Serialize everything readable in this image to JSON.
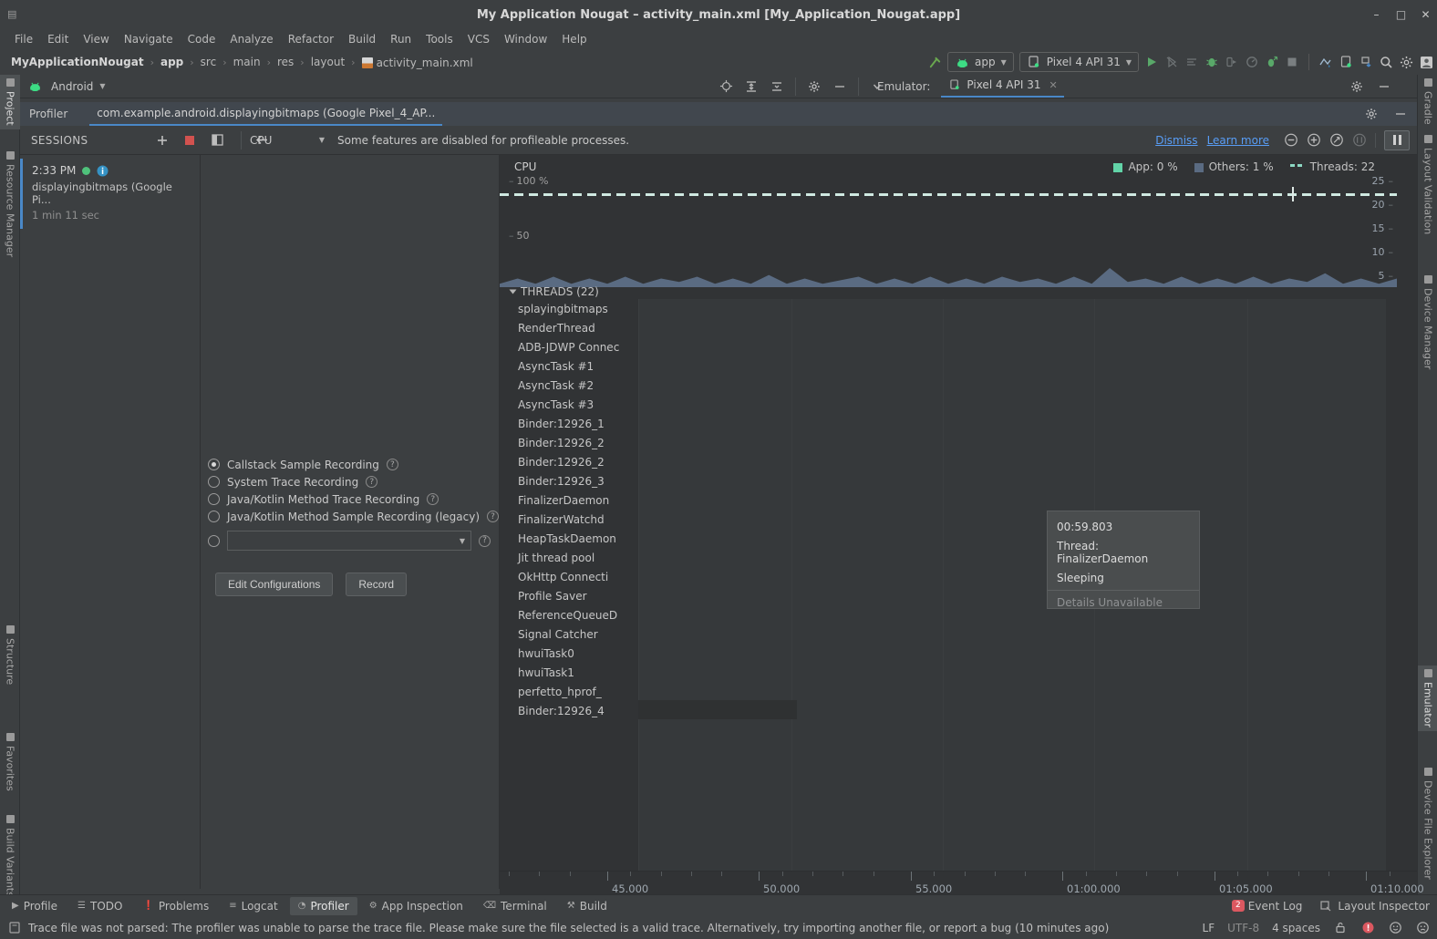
{
  "window": {
    "title": "My Application Nougat – activity_main.xml [My_Application_Nougat.app]",
    "minimize": "–",
    "maximize": "□",
    "close": "✕"
  },
  "menu": {
    "items": [
      "File",
      "Edit",
      "View",
      "Navigate",
      "Code",
      "Analyze",
      "Refactor",
      "Build",
      "Run",
      "Tools",
      "VCS",
      "Window",
      "Help"
    ]
  },
  "breadcrumb": {
    "items": [
      "MyApplicationNougat",
      "app",
      "src",
      "main",
      "res",
      "layout",
      "activity_main.xml"
    ],
    "separator": "›"
  },
  "run_toolbar": {
    "module": "app",
    "device": "Pixel 4 API 31"
  },
  "tool_window": {
    "label": "Android",
    "emulator_label": "Emulator:",
    "emulator_tab": "Pixel 4 API 31",
    "emulator_close": "✕"
  },
  "profiler_tab": {
    "label": "Profiler",
    "session_tab": "com.example.android.displayingbitmaps (Google Pixel_4_AP..."
  },
  "sessions": {
    "title": "SESSIONS",
    "card": {
      "time": "2:33 PM",
      "name": "displayingbitmaps (Google Pi...",
      "duration": "1 min 11 sec"
    }
  },
  "monitor_toolbar": {
    "stage": "CPU",
    "notice": "Some features are disabled for profileable processes.",
    "dismiss": "Dismiss",
    "learn_more": "Learn more"
  },
  "config": {
    "options": [
      {
        "label": "Callstack Sample Recording",
        "selected": true
      },
      {
        "label": "System Trace Recording",
        "selected": false
      },
      {
        "label": "Java/Kotlin Method Trace Recording",
        "selected": false
      },
      {
        "label": "Java/Kotlin Method Sample Recording (legacy)",
        "selected": false
      }
    ],
    "custom_value": "",
    "edit_configurations": "Edit Configurations",
    "record": "Record"
  },
  "cpu": {
    "title": "CPU",
    "legend": [
      {
        "label": "App: 0 %",
        "color": "#62d4a8",
        "style": "swatch"
      },
      {
        "label": "Others: 1 %",
        "color": "#5a6b82",
        "style": "swatch"
      },
      {
        "label": "Threads: 22",
        "color": "#cfe9e1",
        "style": "dashed"
      }
    ],
    "y_left": [
      "100 %",
      "50"
    ],
    "y_right": [
      "25",
      "20",
      "15",
      "10",
      "5"
    ]
  },
  "threads": {
    "header": "THREADS (22)",
    "names": [
      "splayingbitmaps",
      "RenderThread",
      "ADB-JDWP Connec",
      "AsyncTask #1",
      "AsyncTask #2",
      "AsyncTask #3",
      "Binder:12926_1",
      "Binder:12926_2",
      "Binder:12926_2",
      "Binder:12926_3",
      "FinalizerDaemon",
      "FinalizerWatchd",
      "HeapTaskDaemon",
      "Jit thread pool",
      "OkHttp Connecti",
      "Profile Saver",
      "ReferenceQueueD",
      "Signal Catcher",
      "hwuiTask0",
      "hwuiTask1",
      "perfetto_hprof_",
      "Binder:12926_4"
    ]
  },
  "tooltip": {
    "time": "00:59.803",
    "thread": "Thread: FinalizerDaemon",
    "state": "Sleeping",
    "details": "Details Unavailable"
  },
  "timeline": {
    "labels": [
      "45.000",
      "50.000",
      "55.000",
      "01:00.000",
      "01:05.000",
      "01:10.000"
    ]
  },
  "left_rail": {
    "items": [
      "Project",
      "Resource Manager",
      "Structure",
      "Favorites",
      "Build Variants"
    ]
  },
  "right_rail": {
    "items": [
      "Gradle",
      "Layout Validation",
      "Device Manager",
      "Emulator",
      "Device File Explorer"
    ]
  },
  "bottom_tabs": {
    "items": [
      "Profile",
      "TODO",
      "Problems",
      "Logcat",
      "Profiler",
      "App Inspection",
      "Terminal",
      "Build"
    ],
    "active": "Profiler",
    "event_log": "Event Log",
    "event_log_count": "2",
    "layout_inspector": "Layout Inspector"
  },
  "status": {
    "message": "Trace file was not parsed: The profiler was unable to parse the trace file. Please make sure the file selected is a valid trace. Alternatively, try importing another file, or report a bug (10 minutes ago)",
    "line_sep": "LF",
    "encoding": "UTF-8",
    "indent": "4 spaces"
  },
  "chart_data": {
    "type": "area",
    "title": "CPU",
    "ylabel": "CPU %",
    "ylim": [
      0,
      100
    ],
    "y_right_lim": [
      0,
      27
    ],
    "x": [
      0,
      2,
      4,
      6,
      8,
      10,
      12,
      14,
      16,
      18,
      20,
      22,
      24,
      26,
      28,
      30,
      32,
      34,
      36,
      38,
      40,
      42,
      44,
      46,
      48,
      50,
      52,
      54,
      56,
      58,
      60,
      62,
      64,
      66,
      68,
      70,
      72,
      74,
      76,
      78,
      80,
      82,
      84,
      86,
      88,
      90,
      92,
      94,
      96,
      98,
      100
    ],
    "series": [
      {
        "name": "Others",
        "color": "#5a6b82",
        "values": [
          2,
          5,
          2,
          6,
          2,
          5,
          2,
          6,
          2,
          5,
          3,
          6,
          2,
          5,
          2,
          7,
          2,
          5,
          2,
          4,
          6,
          2,
          5,
          2,
          6,
          2,
          5,
          2,
          6,
          3,
          5,
          2,
          6,
          2,
          11,
          3,
          5,
          2,
          6,
          2,
          5,
          2,
          6,
          2,
          5,
          3,
          8,
          2,
          5,
          2,
          5
        ]
      },
      {
        "name": "App",
        "color": "#62d4a8",
        "values": [
          0,
          0,
          0,
          0,
          0,
          0,
          0,
          0,
          0,
          0,
          0,
          0,
          0,
          0,
          0,
          0,
          0,
          0,
          0,
          0,
          0,
          0,
          0,
          0,
          0,
          0,
          0,
          0,
          0,
          0,
          0,
          0,
          0,
          0,
          0,
          0,
          0,
          0,
          0,
          0,
          0,
          0,
          0,
          0,
          0,
          0,
          0,
          0,
          0,
          0,
          0
        ]
      }
    ],
    "threads_line": {
      "name": "Threads",
      "value": 22,
      "color": "#cfe9e1",
      "style": "dashed"
    },
    "xticks": [
      "45.000",
      "50.000",
      "55.000",
      "01:00.000",
      "01:05.000",
      "01:10.000"
    ],
    "grid": false,
    "legend_position": "top-right"
  }
}
